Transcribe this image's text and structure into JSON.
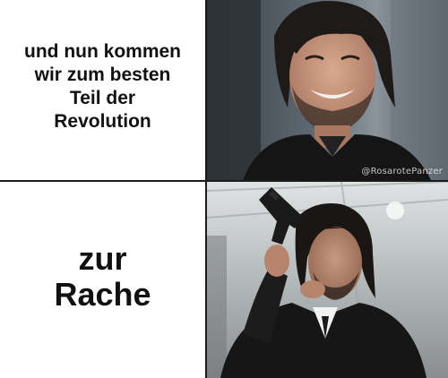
{
  "panels": {
    "top_text": "und nun kommen wir zum besten Teil der Revolution",
    "bottom_text": "zur Rache",
    "watermark": "@RosarotePanzer"
  },
  "colors": {
    "divider": "#1b1b1b",
    "text": "#111111",
    "background": "#ffffff"
  }
}
